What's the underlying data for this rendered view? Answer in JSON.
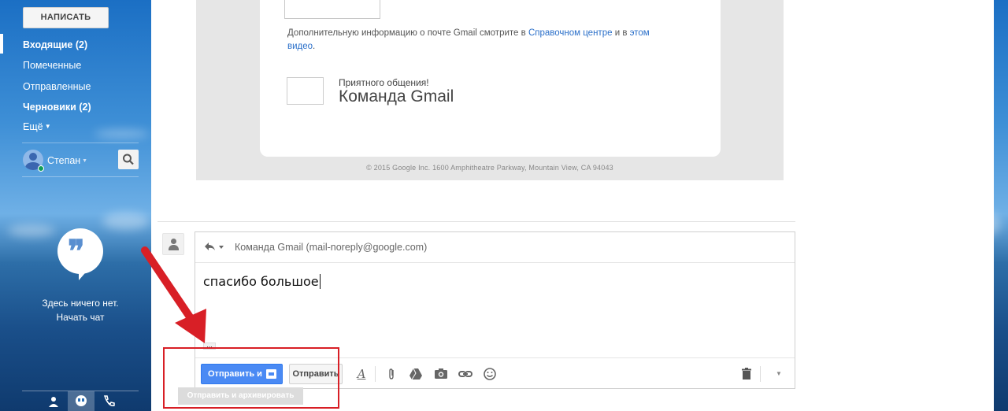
{
  "sidebar": {
    "compose_label": "НАПИСАТЬ",
    "nav": [
      {
        "label": "Входящие (2)",
        "bold": true,
        "active": true
      },
      {
        "label": "Помеченные",
        "bold": false
      },
      {
        "label": "Отправленные",
        "bold": false
      },
      {
        "label": "Черновики (2)",
        "bold": true
      },
      {
        "label": "Ещё",
        "bold": false
      }
    ],
    "user_name": "Степан",
    "hangouts_empty": "Здесь ничего нет.",
    "hangouts_start": "Начать чат"
  },
  "email": {
    "info_prefix": "Дополнительную информацию о почте Gmail смотрите в ",
    "info_link1": "Справочном центре",
    "info_mid": " и в ",
    "info_link2a": "этом",
    "info_link2b": "видео",
    "info_end": ".",
    "sig_small": "Приятного общения!",
    "sig_big": "Команда Gmail",
    "copyright": "© 2015 Google Inc. 1600 Amphitheatre Parkway, Mountain View, CA 94043"
  },
  "reply": {
    "to": "Команда Gmail (mail-noreply@google.com)",
    "body": "спасибо большое",
    "dots": "...",
    "send_archive_label": "Отправить и",
    "send_label": "Отправить",
    "tooltip": "Отправить и архивировать"
  },
  "colors": {
    "primary_button": "#4a8af4",
    "annotation_red": "#d81f26",
    "link": "#2a6fc9"
  }
}
